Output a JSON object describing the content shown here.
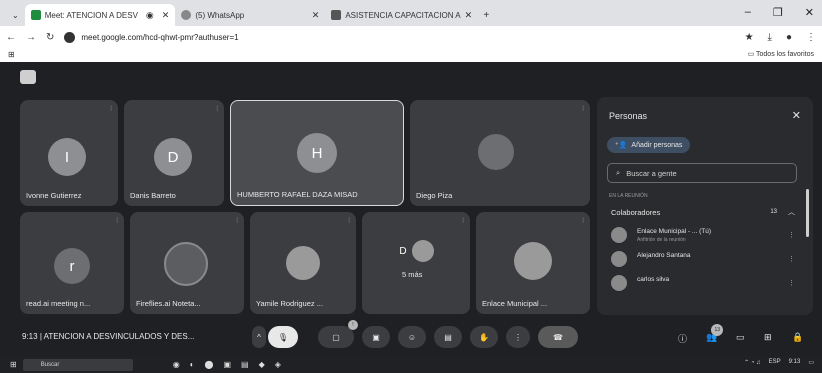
{
  "tabs": [
    {
      "label": "Meet: ATENCION A DESV",
      "active": true
    },
    {
      "label": "(5) WhatsApp",
      "active": false
    },
    {
      "label": "ASISTENCIA CAPACITACION A",
      "active": false
    }
  ],
  "toolbar": {
    "url": "meet.google.com/hcd-qhwt-pmr?authuser=1"
  },
  "bookmarks": {
    "all_label": "Todos los favoritos"
  },
  "tiles": [
    {
      "name": "Ivonne Gutierrez",
      "initial": "I",
      "color": "#8e8f93"
    },
    {
      "name": "Danis Barreto",
      "initial": "D",
      "color": "#8e8f93"
    },
    {
      "name": "HUMBERTO RAFAEL DAZA MISAD",
      "initial": "H",
      "color": "#8e8f93"
    },
    {
      "name": "Diego Piza",
      "initial": "",
      "color": "#6d6e72"
    },
    {
      "name": "read.ai meeting n...",
      "initial": "r",
      "color": "#6d6e72"
    },
    {
      "name": "Fireflies.ai Noteta...",
      "initial": "",
      "color": "#5c5d60"
    },
    {
      "name": "Yamile Rodriguez ...",
      "initial": "",
      "color": "#9a9a9a"
    },
    {
      "name": "",
      "initial": "D",
      "color": "#3c3d40",
      "more": "5 más"
    },
    {
      "name": "Enlace Municipal ...",
      "initial": "",
      "color": "#9a9a9a"
    }
  ],
  "side": {
    "title": "Personas",
    "add_label": "Añadir personas",
    "search_placeholder": "Buscar a gente",
    "in_meeting": "EN LA REUNIÓN",
    "group": "Colaboradores",
    "group_count": "13",
    "people": [
      {
        "name": "Enlace Municipal - ... (Tú)",
        "sub": "Anfitrión de la reunión"
      },
      {
        "name": "Alejandro Santana",
        "sub": ""
      },
      {
        "name": "carlos silva",
        "sub": ""
      }
    ]
  },
  "bottom": {
    "time": "9:13",
    "title": "ATENCION A DESVINCULADOS Y DES...",
    "people_badge": "13"
  },
  "taskbar": {
    "search": "Buscar",
    "lang": "ESP",
    "clock": "9:13"
  }
}
